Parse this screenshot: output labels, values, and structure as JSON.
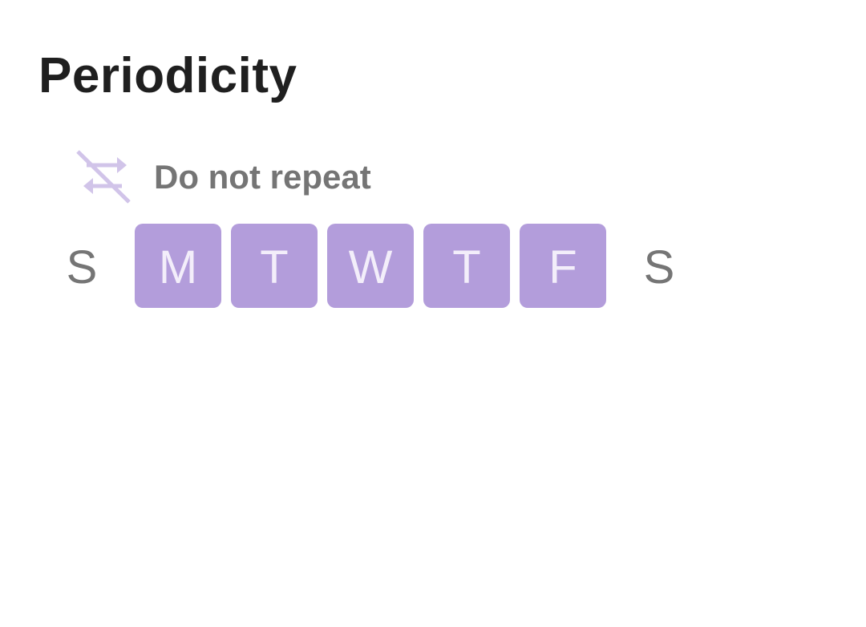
{
  "section": {
    "title": "Periodicity"
  },
  "repeat": {
    "label": "Do not repeat",
    "icon": "repeat-off-icon",
    "icon_color": "#d1c4e9"
  },
  "colors": {
    "day_selected_bg": "#b39ddb",
    "day_selected_text": "#f3eefa",
    "day_unselected_text": "#757575",
    "title_text": "#1f1f1f"
  },
  "days": [
    {
      "label": "S",
      "selected": false
    },
    {
      "label": "M",
      "selected": true
    },
    {
      "label": "T",
      "selected": true
    },
    {
      "label": "W",
      "selected": true
    },
    {
      "label": "T",
      "selected": true
    },
    {
      "label": "F",
      "selected": true
    },
    {
      "label": "S",
      "selected": false
    }
  ]
}
